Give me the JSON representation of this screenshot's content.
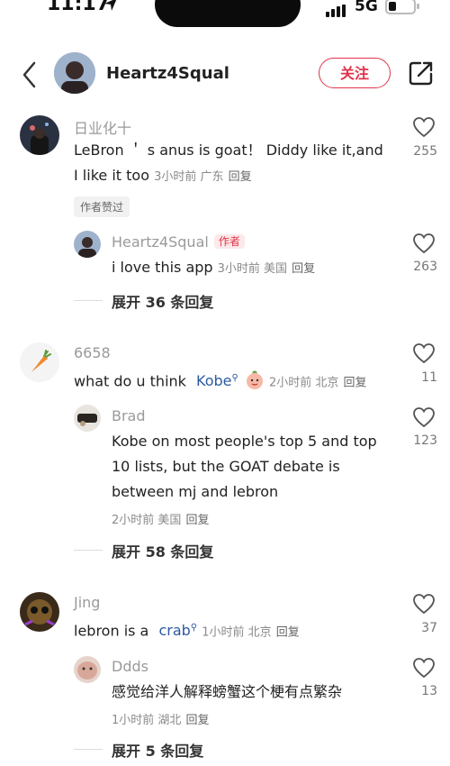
{
  "status_bar": {
    "time": "11:17",
    "network": "5G"
  },
  "header": {
    "username": "Heartz4Squal",
    "follow_label": "关注"
  },
  "comments": [
    {
      "username": "日业化十",
      "text_line1": "LeBron ＇ s anus is goat！ Diddy like it,and",
      "text_line2": "I like it too",
      "meta": "3小时前 广东",
      "reply_label": "回复",
      "likes": "255",
      "liked_badge": "作者赞过",
      "reply": {
        "username": "Heartz4Squal",
        "badge": "作者",
        "text": "i love this app",
        "meta": "3小时前 美国",
        "reply_label": "回复",
        "likes": "263"
      },
      "expand": "展开 36 条回复"
    },
    {
      "username": "6658",
      "text": "what do u think",
      "mention": "Kobe",
      "meta": "2小时前 北京",
      "reply_label": "回复",
      "likes": "11",
      "reply": {
        "username": "Brad",
        "text_line1": "Kobe on most people's top 5 and top",
        "text_line2": "10 lists, but the GOAT debate is",
        "text_line3": "between mj and lebron",
        "meta": "2小时前 美国",
        "reply_label": "回复",
        "likes": "123"
      },
      "expand": "展开 58 条回复"
    },
    {
      "username": "Jing",
      "text": "lebron is a",
      "mention": "crab",
      "meta": "1小时前 北京",
      "reply_label": "回复",
      "likes": "37",
      "reply": {
        "username": "Ddds",
        "text": "感觉给洋人解释螃蟹这个梗有点繁杂",
        "meta": "1小时前 湖北",
        "reply_label": "回复",
        "likes": "13"
      },
      "expand": "展开 5 条回复"
    }
  ],
  "colors": {
    "accent_red": "#e0344a",
    "link_blue": "#2c5aa0"
  }
}
